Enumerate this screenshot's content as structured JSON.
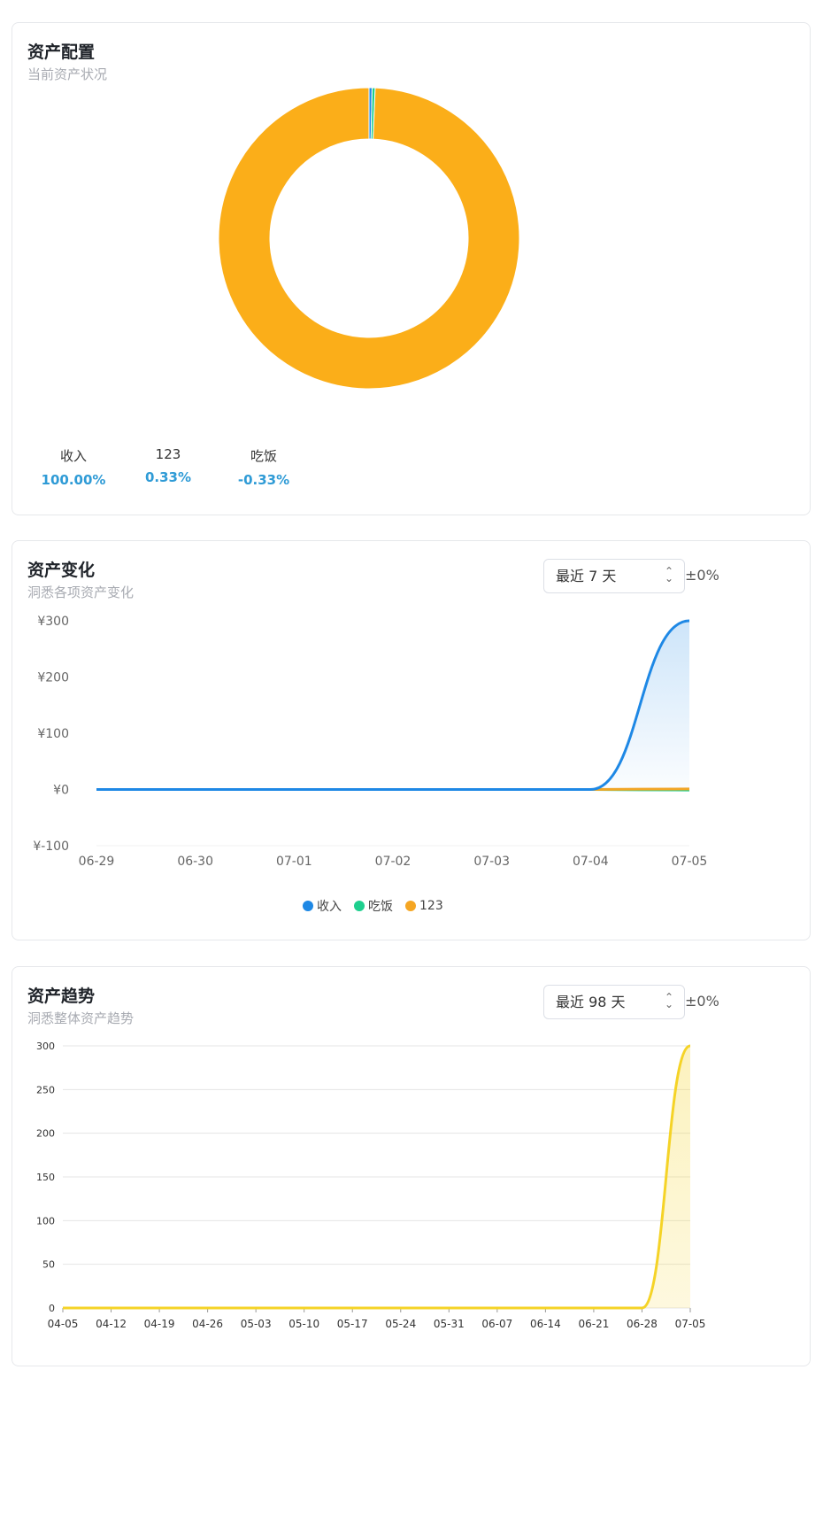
{
  "allocation": {
    "title": "资产配置",
    "subtitle": "当前资产状况",
    "stats": [
      {
        "label": "收入",
        "value": "100.00%"
      },
      {
        "label": "123",
        "value": "0.33%"
      },
      {
        "label": "吃饭",
        "value": "-0.33%"
      }
    ]
  },
  "change": {
    "title": "资产变化",
    "subtitle": "洞悉各项资产变化",
    "range_label": "最近 7 天",
    "change_pct": "±0%",
    "legend": [
      {
        "name": "收入",
        "color": "#1e88e5"
      },
      {
        "name": "吃饭",
        "color": "#1ecf8e"
      },
      {
        "name": "123",
        "color": "#f5a623"
      }
    ]
  },
  "trend": {
    "title": "资产趋势",
    "subtitle": "洞悉整体资产趋势",
    "range_label": "最近 98 天",
    "change_pct": "±0%"
  },
  "chart_data": [
    {
      "type": "pie",
      "variant": "donut",
      "labels": [
        "收入",
        "123",
        "吃饭"
      ],
      "values": [
        100.0,
        0.33,
        -0.33
      ],
      "colors": [
        "#fbae19",
        "#1e88e5",
        "#1ecf8e"
      ]
    },
    {
      "type": "area",
      "x": [
        "06-29",
        "06-30",
        "07-01",
        "07-02",
        "07-03",
        "07-04",
        "07-05"
      ],
      "ylim": [
        -100,
        300
      ],
      "yticks": [
        -100,
        0,
        100,
        200,
        300
      ],
      "ytick_labels": [
        "¥-100",
        "¥0",
        "¥100",
        "¥200",
        "¥300"
      ],
      "series": [
        {
          "name": "收入",
          "color": "#1e88e5",
          "values": [
            0,
            0,
            0,
            0,
            0,
            0,
            300
          ]
        },
        {
          "name": "吃饭",
          "color": "#1ecf8e",
          "values": [
            0,
            0,
            0,
            0,
            0,
            0,
            -1
          ]
        },
        {
          "name": "123",
          "color": "#f5a623",
          "values": [
            0,
            0,
            0,
            0,
            0,
            0,
            1
          ]
        }
      ]
    },
    {
      "type": "area",
      "x": [
        "04-05",
        "04-12",
        "04-19",
        "04-26",
        "05-03",
        "05-10",
        "05-17",
        "05-24",
        "05-31",
        "06-07",
        "06-14",
        "06-21",
        "06-28",
        "07-05"
      ],
      "ylim": [
        0,
        300
      ],
      "yticks": [
        0,
        50,
        100,
        150,
        200,
        250,
        300
      ],
      "grid": true,
      "series": [
        {
          "color": "#f5d327",
          "values": [
            0,
            0,
            0,
            0,
            0,
            0,
            0,
            0,
            0,
            0,
            0,
            0,
            0,
            300
          ]
        }
      ]
    }
  ]
}
